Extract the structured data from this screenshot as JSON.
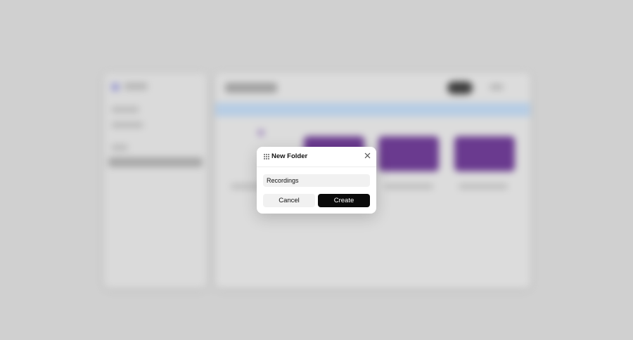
{
  "dialog": {
    "title": "New Folder",
    "folder_name_value": "Recordings",
    "folder_name_placeholder": "",
    "cancel_label": "Cancel",
    "create_label": "Create"
  },
  "icons": {
    "drag_handle": "drag-handle-icon",
    "close": "close-icon"
  },
  "colors": {
    "overlay_background": "#d0d0d0",
    "primary_button": "#0a0a0a",
    "secondary_button": "#f1f1f1",
    "thumbnail_accent": "#6a3a8f",
    "banner": "#b7cde4"
  }
}
